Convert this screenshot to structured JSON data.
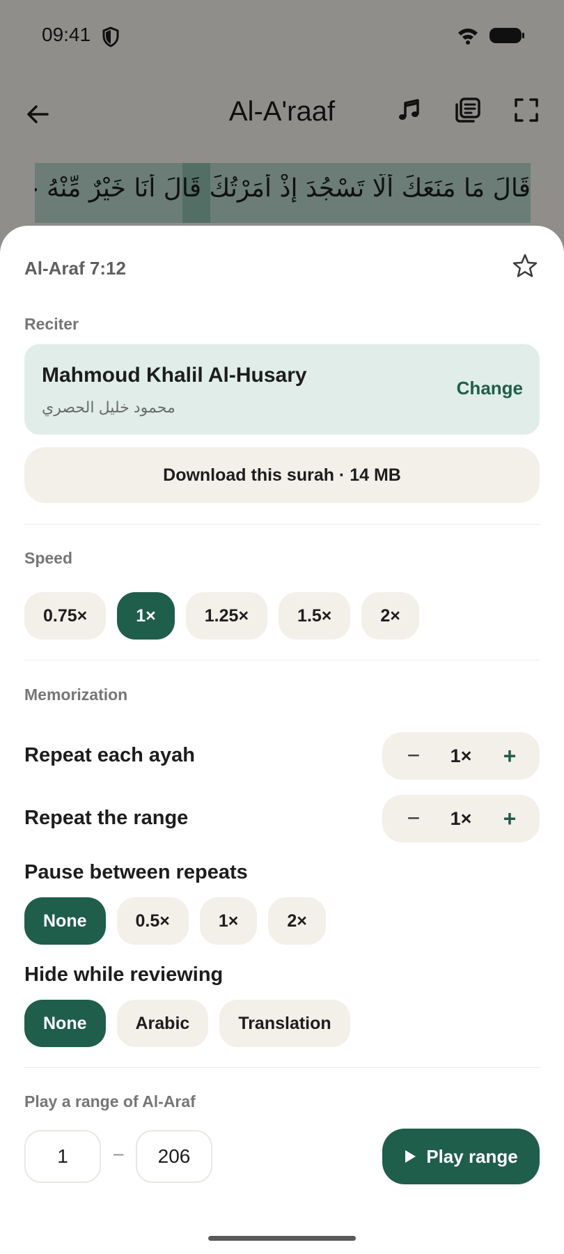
{
  "status_bar": {
    "time": "09:41"
  },
  "app_bar": {
    "title": "Al-A'raaf"
  },
  "ayah": {
    "text": "قَالَ مَا مَنَعَكَ أَلَّا تَسْجُدَ إِذْ أَمَرْتُكَ قَالَ أَنَا خَيْرٌ مِّنْهُ خَلَقْتَنِي مِن نَّارٍ"
  },
  "sheet": {
    "title": "Al-Araf 7:12",
    "reciter_label": "Reciter",
    "reciter_name": "Mahmoud Khalil Al-Husary",
    "reciter_name_arabic": "محمود خليل الحصري",
    "change_label": "Change",
    "download_label": "Download this surah · 14 MB",
    "speed_label": "Speed",
    "speed_options": [
      "0.75×",
      "1×",
      "1.25×",
      "1.5×",
      "2×"
    ],
    "speed_selected": "1×",
    "memorization_label": "Memorization",
    "repeat_ayah_label": "Repeat each ayah",
    "repeat_ayah_value": "1×",
    "repeat_range_label": "Repeat the range",
    "repeat_range_value": "1×",
    "stepper_minus": "−",
    "stepper_plus": "+",
    "pause_label": "Pause between repeats",
    "pause_options": [
      "None",
      "0.5×",
      "1×",
      "2×"
    ],
    "pause_selected": "None",
    "hide_label": "Hide while reviewing",
    "hide_options": [
      "None",
      "Arabic",
      "Translation"
    ],
    "hide_selected": "None",
    "range_label": "Play a range of Al-Araf",
    "range_from": "1",
    "range_dash": "–",
    "range_to": "206",
    "play_range_label": "Play range"
  },
  "colors": {
    "accent": "#1f5e4a",
    "chip_bg": "#f3efe9",
    "reciter_card_bg": "#e0ede8"
  }
}
